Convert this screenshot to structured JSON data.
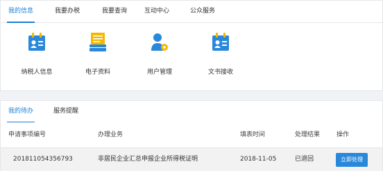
{
  "top_tabs": [
    "我的信息",
    "我要办税",
    "我要查询",
    "互动中心",
    "公众服务"
  ],
  "shortcuts": [
    {
      "label": "纳税人信息",
      "icon": "id-card-icon"
    },
    {
      "label": "电子资料",
      "icon": "document-stack-icon"
    },
    {
      "label": "用户管理",
      "icon": "user-settings-icon"
    },
    {
      "label": "文书接收",
      "icon": "id-card-icon"
    }
  ],
  "sub_tabs": [
    "我的待办",
    "服务提醒"
  ],
  "table": {
    "headers": [
      "申请事项编号",
      "办理业务",
      "填表时间",
      "处理结果",
      "操作"
    ],
    "rows": [
      {
        "id": "201811054356793",
        "business": "非居民企业汇总申报企业所得税证明",
        "date": "2018-11-05",
        "result": "已退回",
        "action": "立即处理"
      }
    ]
  },
  "colors": {
    "accent": "#1a7fd6",
    "icon_blue": "#2a88db",
    "icon_yellow": "#f5b800"
  }
}
